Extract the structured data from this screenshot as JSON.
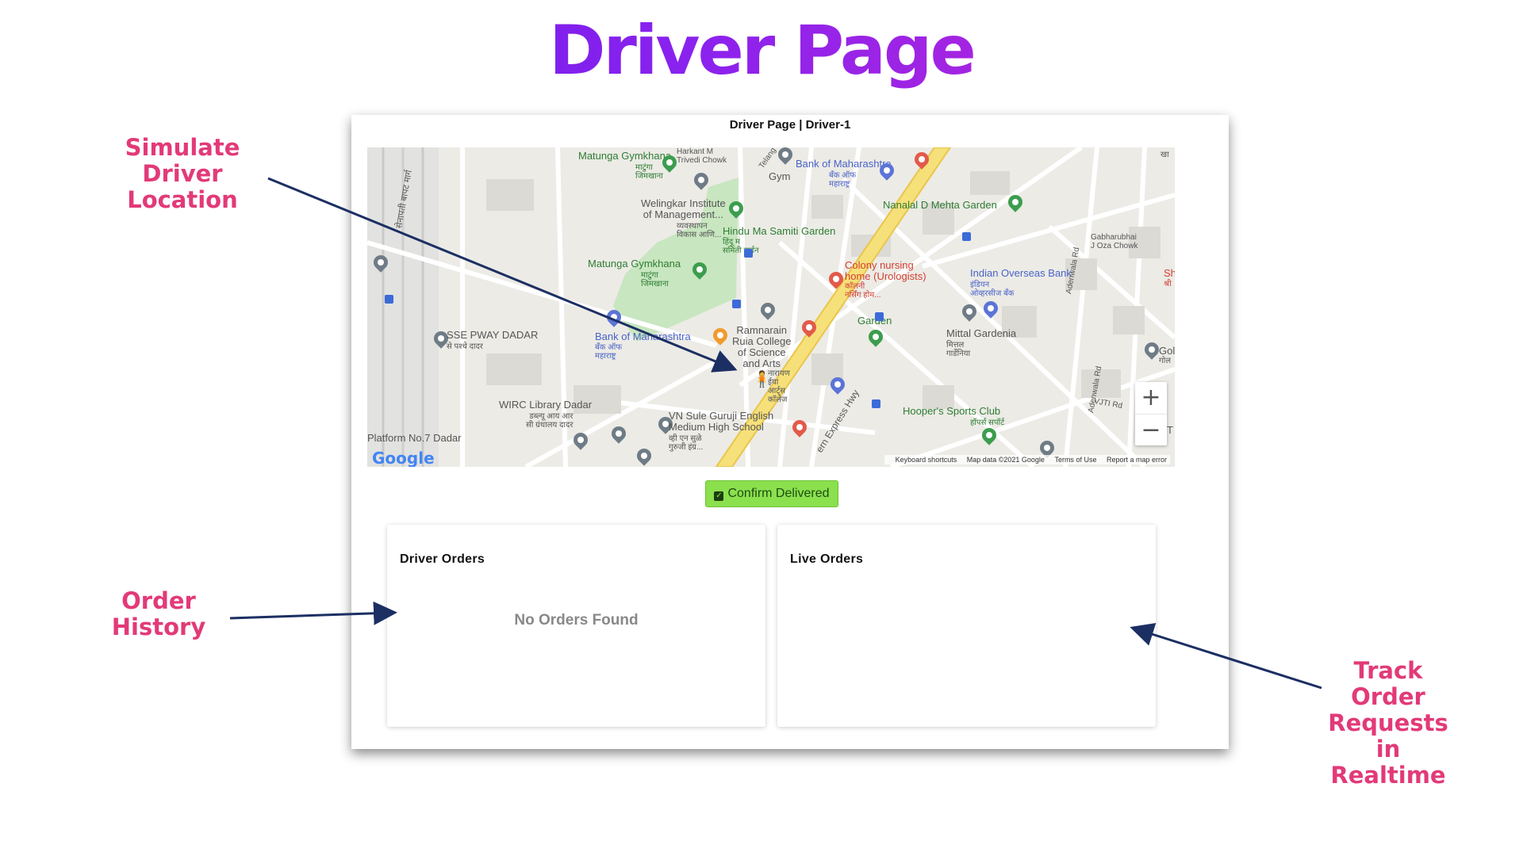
{
  "slide": {
    "title": "Driver Page",
    "callouts": {
      "simulate": "Simulate\nDriver\nLocation",
      "history": "Order\nHistory",
      "track": "Track\nOrder\nRequests in\nRealtime"
    }
  },
  "window": {
    "title": "Driver Page | Driver-1"
  },
  "map": {
    "labels": {
      "matunga_gym_1": "Matunga Gymkhana",
      "matunga_gym_1_local": "माटुंगा\nजिमखाना",
      "harkant": "Harkant M\nTrivedi Chowk",
      "gym": "Gym",
      "bom_top": "Bank of Maharashtra",
      "bom_top_local": "बँक ऑफ\nमहाराष्ट्र",
      "welingkar": "Welingkar Institute\nof Management...",
      "welingkar_local": "व्यवस्थापन\nविकास आणि...",
      "nanalal": "Nanalal D Mehta Garden",
      "hindu_ma": "Hindu Ma Samiti Garden",
      "hindu_ma_local": "हिंदू म\nसमिती गार्डन",
      "gabharubhai": "Gabharubhai\nJ Oza Chowk",
      "matunga_gym_2": "Matunga Gymkhana",
      "matunga_gym_2_local": "माटुंगा\nजिमखाना",
      "colony": "Colony nursing\nhome (Urologists)",
      "colony_local": "कॉलनी\nनर्सिंग होम...",
      "indian_overseas": "Indian Overseas Bank",
      "indian_overseas_local": "इंडियन\nओव्हरसीज बँक",
      "garden": "Garden",
      "mittal": "Mittal Gardenia",
      "mittal_local": "मित्तल\nगार्डेनिया",
      "sse": "SSE PWAY DADAR",
      "sse_local": "से पश्चे दादर",
      "bom_mid": "Bank of Maharashtra",
      "bom_mid_local": "बँक ऑफ\nमहाराष्ट्र",
      "ruia": "Ramnarain\nRuia College\nof Science\nand Arts",
      "ruia_local": "नारायण\nईया\nआर्ट्स\nकॉलेज",
      "wirc": "WIRC Library Dadar",
      "wirc_local": "डब्ल्यू आय आर\nसी ग्रंथालय दादर",
      "vn_sule": "VN Sule Guruji English\nMedium High School",
      "vn_sule_local": "व्ही एन सुळे\nगुरुजी इंग्र...",
      "hoopers": "Hooper's Sports Club",
      "hoopers_local": "हॉपर्स सपॉर्ट",
      "platform": "Platform No.7 Dadar",
      "highway": "ern Express Hwy",
      "adenwala": "Adenwala Rd",
      "adenwala_2": "Adenwala Rd",
      "vjti": "VJTI Rd",
      "telang": "Telang R",
      "road_left": "सेनापती बापट मार्ग",
      "gol": "Gol",
      "gol_local": "गोल",
      "sh": "Sh",
      "sh_local": "श्री",
      "kha": "खा",
      "edge_t": "T"
    },
    "zoom_in": "+",
    "zoom_out": "−",
    "logo": "Google",
    "footer": {
      "shortcuts": "Keyboard shortcuts",
      "data": "Map data ©2021 Google",
      "terms": "Terms of Use",
      "report": "Report a map error"
    }
  },
  "actions": {
    "confirm_label": "Confirm Delivered"
  },
  "driver_orders": {
    "title": "Driver Orders",
    "empty": "No Orders Found"
  },
  "live_orders": {
    "title": "Live Orders"
  },
  "colors": {
    "callout": "#e23a78",
    "title_gradient_start": "#5a17e8",
    "title_gradient_end": "#d42ac9",
    "confirm_bg": "#8be04e",
    "arrow": "#1c2f63"
  }
}
